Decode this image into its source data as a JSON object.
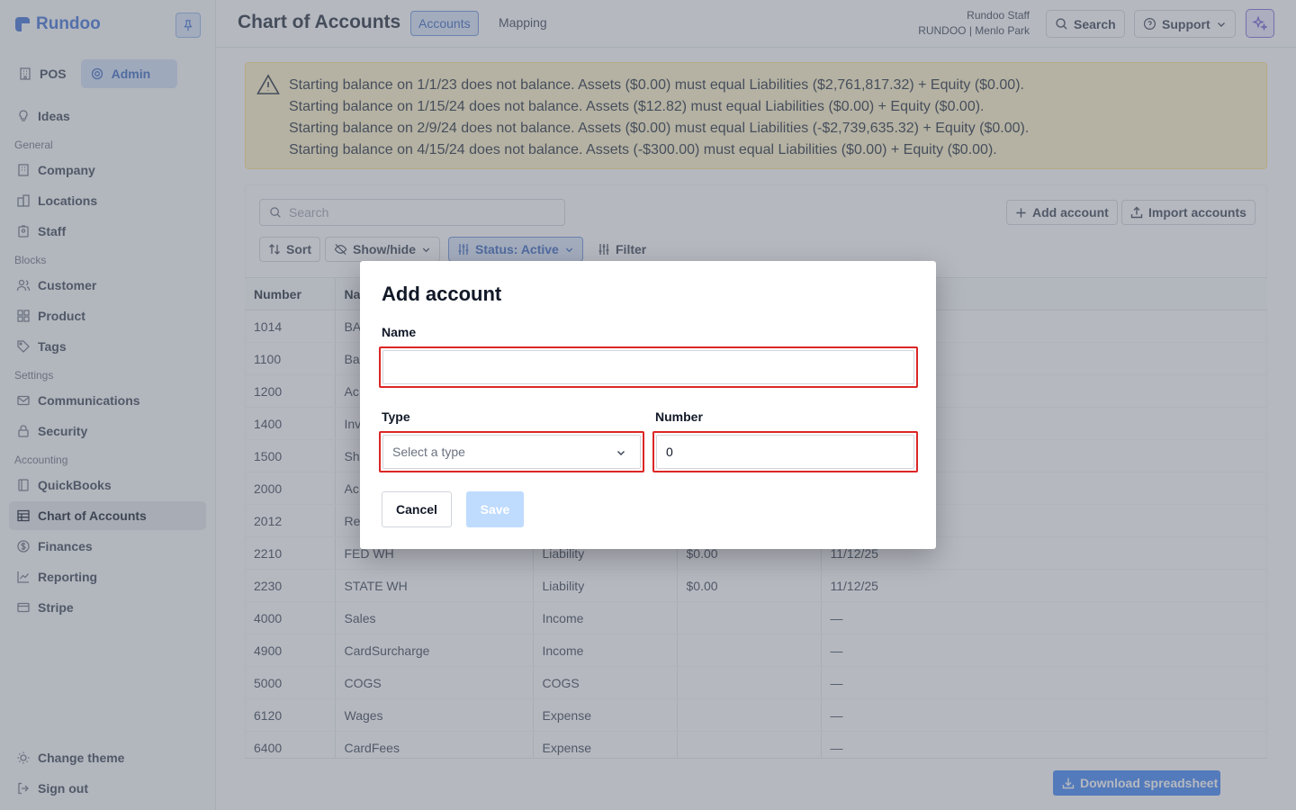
{
  "app": {
    "brand": "Rundoo"
  },
  "sidebar": {
    "modes": [
      {
        "label": "POS"
      },
      {
        "label": "Admin"
      }
    ],
    "ideas": "Ideas",
    "sections": [
      {
        "title": "General",
        "items": [
          {
            "label": "Company"
          },
          {
            "label": "Locations"
          },
          {
            "label": "Staff"
          }
        ]
      },
      {
        "title": "Blocks",
        "items": [
          {
            "label": "Customer"
          },
          {
            "label": "Product"
          },
          {
            "label": "Tags"
          }
        ]
      },
      {
        "title": "Settings",
        "items": [
          {
            "label": "Communications"
          },
          {
            "label": "Security"
          }
        ]
      },
      {
        "title": "Accounting",
        "items": [
          {
            "label": "QuickBooks"
          },
          {
            "label": "Chart of Accounts"
          },
          {
            "label": "Finances"
          },
          {
            "label": "Reporting"
          },
          {
            "label": "Stripe"
          }
        ]
      }
    ],
    "bottom": [
      {
        "label": "Change theme"
      },
      {
        "label": "Sign out"
      }
    ]
  },
  "header": {
    "title": "Chart of Accounts",
    "tabs": [
      {
        "label": "Accounts"
      },
      {
        "label": "Mapping"
      }
    ],
    "user_name": "Rundoo Staff",
    "user_location": "RUNDOO | Menlo Park",
    "search_label": "Search",
    "support_label": "Support"
  },
  "alert": {
    "lines": [
      "Starting balance on 1/1/23 does not balance. Assets ($0.00) must equal Liabilities ($2,761,817.32) + Equity ($0.00).",
      "Starting balance on 1/15/24 does not balance. Assets ($12.82) must equal Liabilities ($0.00) + Equity ($0.00).",
      "Starting balance on 2/9/24 does not balance. Assets ($0.00) must equal Liabilities (-$2,739,635.32) + Equity ($0.00).",
      "Starting balance on 4/15/24 does not balance. Assets (-$300.00) must equal Liabilities ($0.00) + Equity ($0.00)."
    ]
  },
  "toolbar": {
    "search_placeholder": "Search",
    "add_account": "Add account",
    "import_accounts": "Import accounts",
    "sort": "Sort",
    "show_hide": "Show/hide",
    "status_filter": "Status: Active",
    "filter": "Filter"
  },
  "table": {
    "headers": [
      "Number",
      "Na",
      "",
      "",
      ""
    ],
    "rows": [
      [
        "1014",
        "BA",
        "",
        "",
        ""
      ],
      [
        "1100",
        "Ba",
        "",
        "",
        ""
      ],
      [
        "1200",
        "Ac",
        "",
        "",
        ""
      ],
      [
        "1400",
        "Inv",
        "",
        "",
        ""
      ],
      [
        "1500",
        "Sh",
        "",
        "",
        ""
      ],
      [
        "2000",
        "Ac",
        "",
        "",
        ""
      ],
      [
        "2012",
        "Re",
        "",
        "",
        ""
      ],
      [
        "2210",
        "FED WH",
        "Liability",
        "$0.00",
        "11/12/25"
      ],
      [
        "2230",
        "STATE WH",
        "Liability",
        "$0.00",
        "11/12/25"
      ],
      [
        "4000",
        "Sales",
        "Income",
        "",
        "—"
      ],
      [
        "4900",
        "CardSurcharge",
        "Income",
        "",
        "—"
      ],
      [
        "5000",
        "COGS",
        "COGS",
        "",
        "—"
      ],
      [
        "6120",
        "Wages",
        "Expense",
        "",
        "—"
      ],
      [
        "6400",
        "CardFees",
        "Expense",
        "",
        "—"
      ]
    ]
  },
  "footer": {
    "download_label": "Download spreadsheet"
  },
  "modal": {
    "title": "Add account",
    "name_label": "Name",
    "name_value": "",
    "type_label": "Type",
    "type_placeholder": "Select a type",
    "number_label": "Number",
    "number_value": "0",
    "cancel_label": "Cancel",
    "save_label": "Save"
  },
  "colors": {
    "accent": "#3464bf",
    "error": "#dc2626",
    "warning_bg": "#fef3c7"
  }
}
